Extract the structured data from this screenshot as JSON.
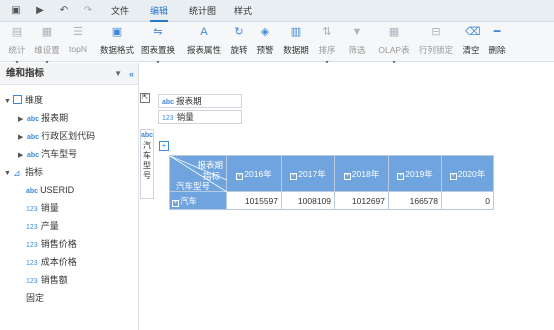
{
  "menus": [
    "文件",
    "编辑",
    "统计图",
    "样式"
  ],
  "active_menu": 1,
  "toolbar": [
    {
      "label": "统计",
      "icon": "stats-icon",
      "disabled": true,
      "dd": true
    },
    {
      "label": "维设置",
      "icon": "dimension-settings-icon",
      "disabled": true,
      "dd": true
    },
    {
      "label": "topN",
      "icon": "topn-icon",
      "disabled": true,
      "dd": false
    },
    {
      "label": "数据格式",
      "icon": "data-format-icon",
      "disabled": false,
      "dd": false
    },
    {
      "label": "图表置换",
      "icon": "chart-swap-icon",
      "disabled": false,
      "dd": true
    },
    {
      "label": "报表属性",
      "icon": "report-properties-icon",
      "disabled": false,
      "dd": false
    },
    {
      "label": "旋转",
      "icon": "rotate-icon",
      "disabled": false,
      "dd": false
    },
    {
      "label": "预警",
      "icon": "warning-icon",
      "disabled": false,
      "dd": false
    },
    {
      "label": "数据期",
      "icon": "data-period-icon",
      "disabled": false,
      "dd": false
    },
    {
      "label": "排序",
      "icon": "sort-icon",
      "disabled": true,
      "dd": true
    },
    {
      "label": "筛选",
      "icon": "filter-icon",
      "disabled": true,
      "dd": false
    },
    {
      "label": "OLAP表",
      "icon": "olap-table-icon",
      "disabled": true,
      "dd": true
    },
    {
      "label": "行列锁定",
      "icon": "lock-rowcol-icon",
      "disabled": true,
      "dd": false
    },
    {
      "label": "清空",
      "icon": "clear-icon",
      "disabled": false,
      "dd": false
    },
    {
      "label": "删除",
      "icon": "delete-icon",
      "disabled": false,
      "dd": false
    }
  ],
  "left_panel": {
    "title": "维和指标",
    "pin": "▼",
    "collapse": "«",
    "dimension_group": "维度",
    "dimensions": [
      "报表期",
      "行政区划代码",
      "汽车型号"
    ],
    "measure_group": "指标",
    "measures": [
      {
        "tag": "abc",
        "label": "USERID"
      },
      {
        "tag": "123",
        "label": "销量"
      },
      {
        "tag": "123",
        "label": "产量"
      },
      {
        "tag": "123",
        "label": "销售价格"
      },
      {
        "tag": "123",
        "label": "成本价格"
      },
      {
        "tag": "123",
        "label": "销售额"
      }
    ],
    "fixed": "固定"
  },
  "main": {
    "column_field": "报表期",
    "measure_field": "销量",
    "row_field_vertical": "汽车型号",
    "header_labels": {
      "report": "报表期",
      "measure": "指标",
      "row": "汽车型号"
    },
    "years": [
      "2016年",
      "2017年",
      "2018年",
      "2019年",
      "2020年"
    ],
    "row_label": "汽车",
    "values": [
      "1015597",
      "1008109",
      "1012697",
      "166578",
      "0"
    ]
  }
}
